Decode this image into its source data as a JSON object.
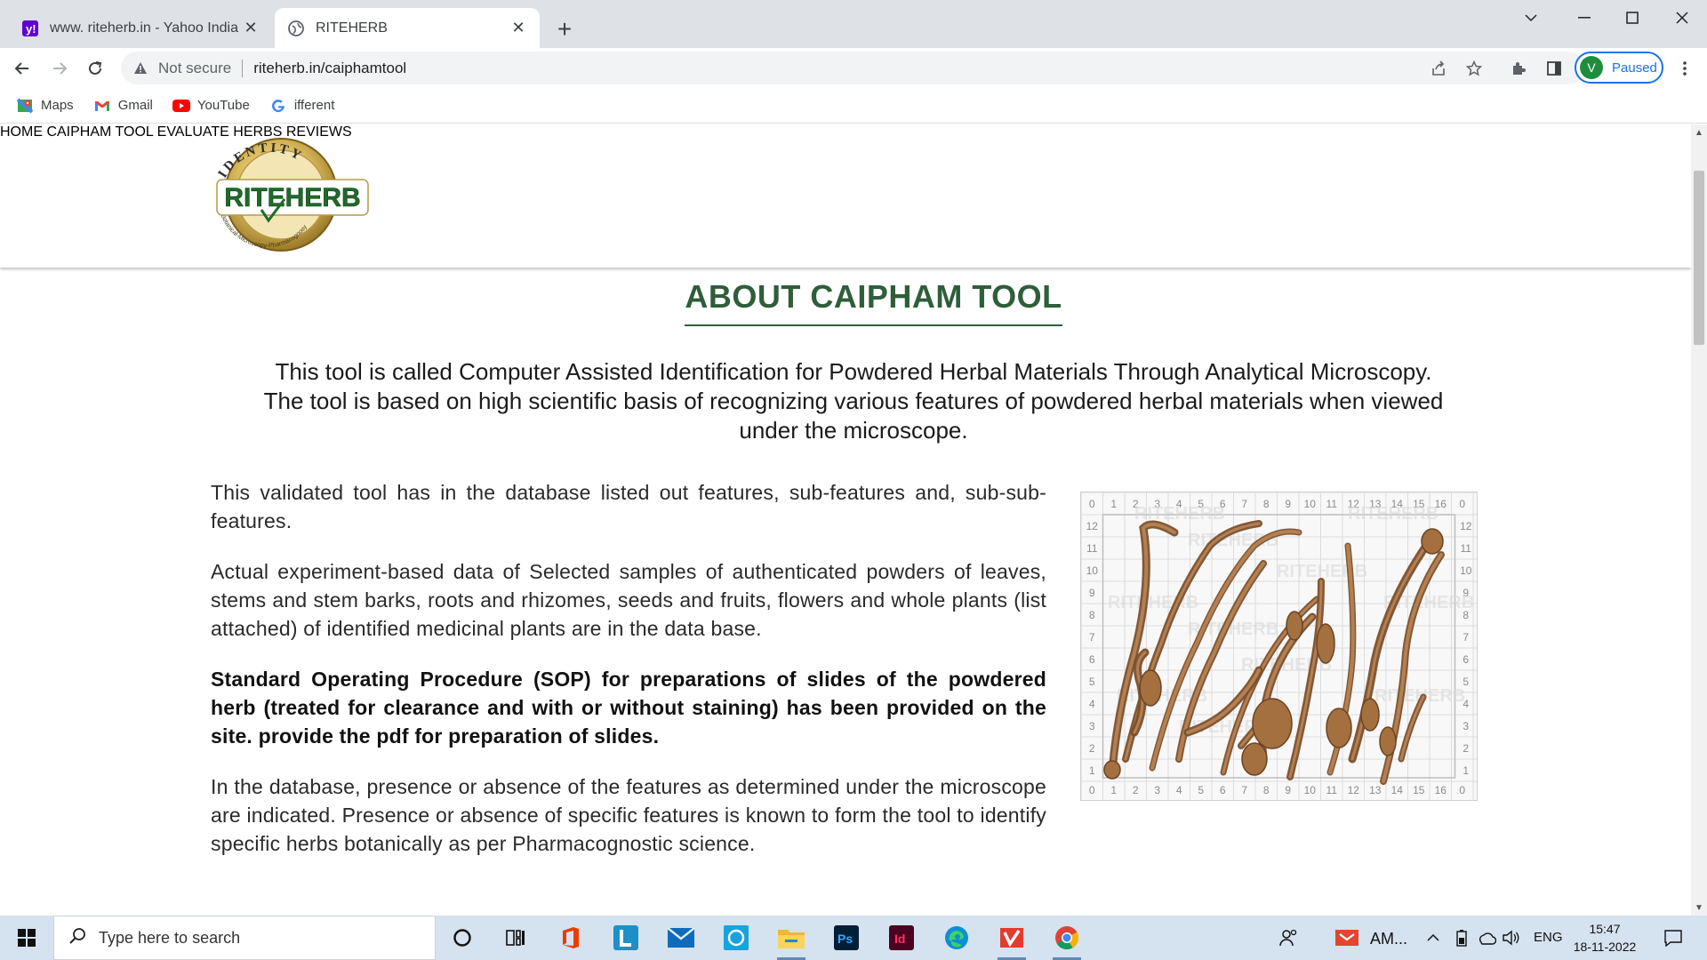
{
  "browser": {
    "tabs": [
      {
        "title": "www. riteherb.in - Yahoo India Se",
        "favicon": "yahoo-icon",
        "active": false
      },
      {
        "title": "RITEHERB",
        "favicon": "globe-icon",
        "active": true
      }
    ],
    "new_tab": "+",
    "address": {
      "security_label": "Not secure",
      "url": "riteherb.in/caiphamtool"
    },
    "profile": {
      "initial": "V",
      "label": "Paused"
    },
    "bookmarks": [
      {
        "label": "Maps",
        "icon": "maps-icon"
      },
      {
        "label": "Gmail",
        "icon": "gmail-icon"
      },
      {
        "label": "YouTube",
        "icon": "youtube-icon"
      },
      {
        "label": "ifferent",
        "icon": "google-icon"
      }
    ]
  },
  "site": {
    "logo": {
      "brand": "RITEHERB",
      "arc_text": "IDENTITY",
      "ring_text": "Botanical-Microscopy-Pharmacognosy"
    },
    "nav": [
      {
        "label": "HOME"
      },
      {
        "label": "CAIPHAM TOOL"
      },
      {
        "label": "EVALUATE HERBS"
      },
      {
        "label": "REVIEWS"
      }
    ],
    "section_title": "ABOUT CAIPHAM TOOL",
    "lead": "This tool is called Computer Assisted Identification for Powdered Herbal Materials Through Analytical Microscopy. The tool is based on high scientific basis of recognizing various features of powdered herbal materials when viewed under the microscope.",
    "paragraphs": [
      {
        "text": "This validated tool has in the database listed out features, sub-features and, sub-sub- features.",
        "bold": false
      },
      {
        "text": "Actual experiment-based data of Selected samples of authenticated powders of leaves, stems and stem barks, roots and rhizomes, seeds and fruits, flowers and whole plants (list attached) of identified medicinal plants are in the data base.",
        "bold": false
      },
      {
        "text": "Standard Operating Procedure (SOP) for preparations of slides of the powdered herb (treated for clearance and with or without staining) has been provided on the site. provide the pdf for preparation of slides.",
        "bold": true
      },
      {
        "text": "In the database, presence or absence of the features as determined under the microscope are indicated. Presence or absence of specific features is known to form the tool to identify specific herbs botanically as per Pharmacognostic science.",
        "bold": false
      }
    ],
    "figure": {
      "watermark": "RITEHERB",
      "grid_top": [
        "0",
        "1",
        "2",
        "3",
        "4",
        "5",
        "6",
        "7",
        "8",
        "9",
        "10",
        "11",
        "12",
        "13",
        "14",
        "15",
        "16",
        "0"
      ],
      "grid_side": [
        "12",
        "11",
        "10",
        "9",
        "8",
        "7",
        "6",
        "5",
        "4",
        "3",
        "2",
        "1"
      ]
    }
  },
  "taskbar": {
    "search_placeholder": "Type here to search",
    "tray_app_label": "AM...",
    "language": "ENG",
    "time": "15:47",
    "date": "18-11-2022"
  },
  "colors": {
    "accent_green": "#2e5e3a",
    "chrome_blue": "#1a73e8",
    "tabstrip": "#dee1e6",
    "taskbar": "#d5e2ef"
  }
}
